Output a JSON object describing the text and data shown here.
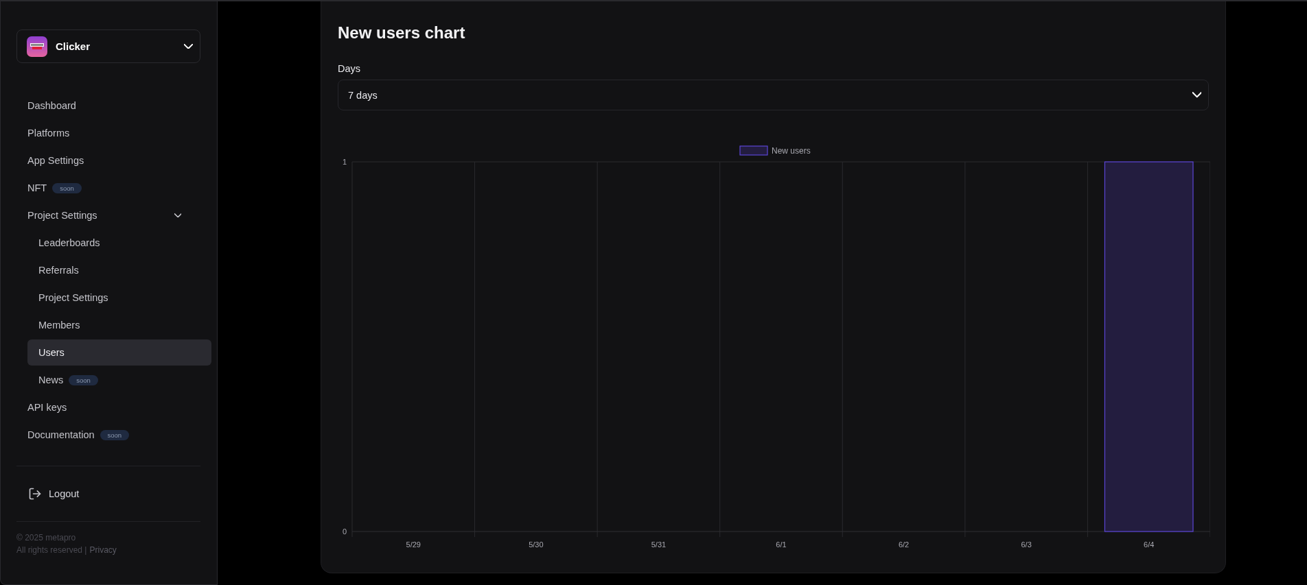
{
  "sidebar": {
    "app_switcher": {
      "name": "Clicker",
      "expanded": false
    },
    "nav": [
      {
        "label": "Dashboard",
        "selected": false
      },
      {
        "label": "Platforms",
        "selected": false
      },
      {
        "label": "App Settings",
        "selected": false
      },
      {
        "label": "NFT",
        "selected": false,
        "badge": "soon"
      },
      {
        "label": "Project Settings",
        "selected": false,
        "expanded": true,
        "children": [
          {
            "label": "Leaderboards",
            "selected": false
          },
          {
            "label": "Referrals",
            "selected": false
          },
          {
            "label": "Project Settings",
            "selected": false
          },
          {
            "label": "Members",
            "selected": false
          },
          {
            "label": "Users",
            "selected": true
          },
          {
            "label": "News",
            "selected": false,
            "badge": "soon"
          }
        ]
      },
      {
        "label": "API keys",
        "selected": false
      },
      {
        "label": "Documentation",
        "selected": false,
        "badge": "soon"
      }
    ],
    "logout": {
      "label": "Logout"
    },
    "footer": {
      "copyright": "© 2025 metapro",
      "rights": "All rights reserved |",
      "privacy_link": "Privacy"
    }
  },
  "main": {
    "title": "New users chart",
    "days_select": {
      "label": "Days",
      "value": "7 days"
    },
    "chart_data": {
      "type": "bar",
      "categories": [
        "5/29",
        "5/30",
        "5/31",
        "6/1",
        "6/2",
        "6/3",
        "6/4"
      ],
      "series": [
        {
          "name": "New users",
          "color": "#5b45d6",
          "values": [
            0,
            0,
            0,
            0,
            0,
            0,
            1
          ]
        }
      ],
      "ylim": [
        0,
        1
      ],
      "yticks": [
        0,
        1
      ]
    }
  }
}
